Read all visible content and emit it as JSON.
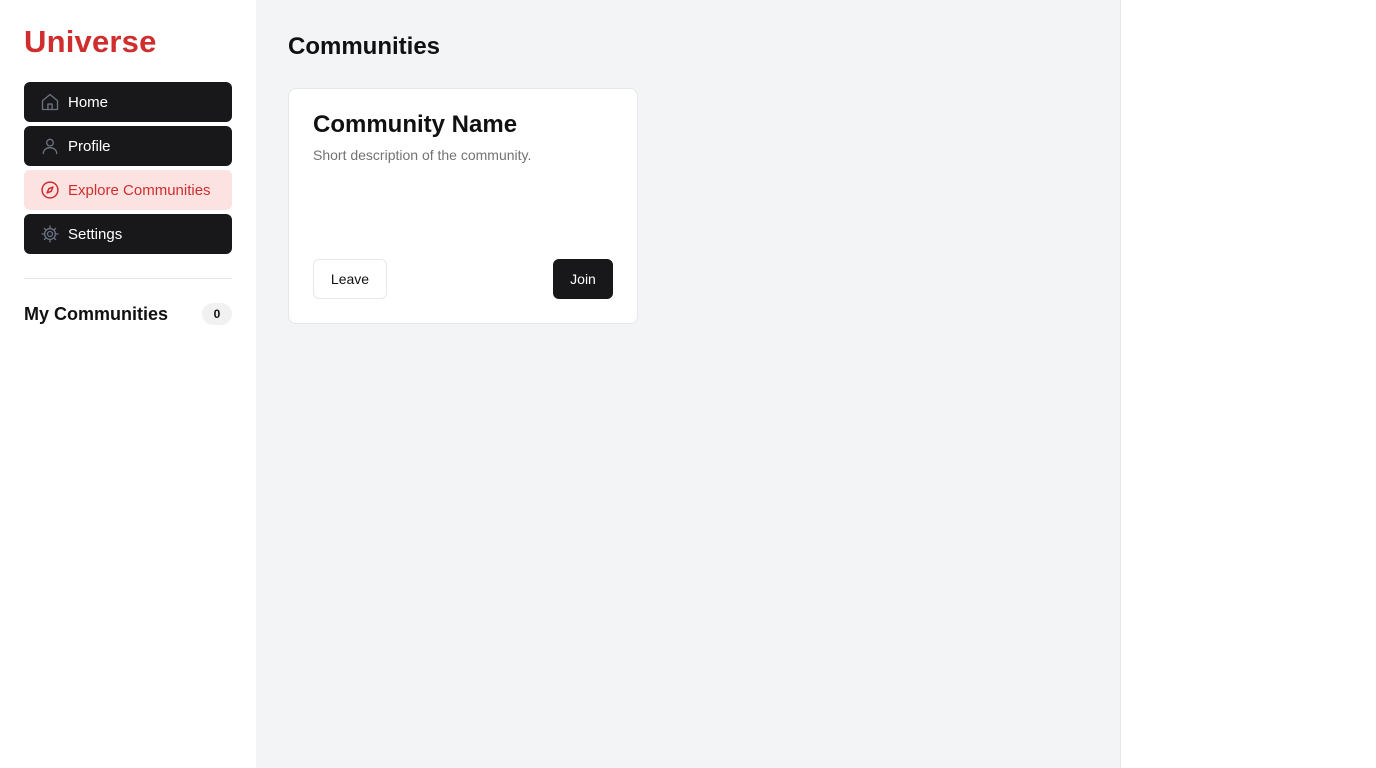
{
  "brand": {
    "name": "Universe",
    "color": "#cf2e2e"
  },
  "sidebar": {
    "items": [
      {
        "label": "Home",
        "icon": "home-icon",
        "active": false
      },
      {
        "label": "Profile",
        "icon": "user-icon",
        "active": false
      },
      {
        "label": "Explore Communities",
        "icon": "compass-icon",
        "active": true
      },
      {
        "label": "Settings",
        "icon": "gear-icon",
        "active": false
      }
    ],
    "my_communities": {
      "title": "My Communities",
      "count": "0"
    }
  },
  "main": {
    "title": "Communities",
    "cards": [
      {
        "name": "Community Name",
        "description": "Short description of the community.",
        "leave_label": "Leave",
        "join_label": "Join"
      }
    ]
  },
  "colors": {
    "nav_bg": "#18181b",
    "active_bg": "#fde2e2",
    "active_text": "#cf2e2e",
    "main_bg": "#f3f4f6"
  }
}
